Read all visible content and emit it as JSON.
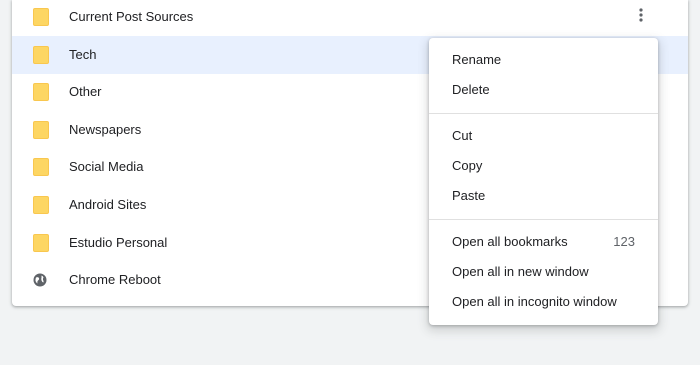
{
  "bookmarks": [
    {
      "label": "Current Post Sources",
      "icon": "folder-icon"
    },
    {
      "label": "Tech",
      "icon": "folder-icon",
      "selected": true
    },
    {
      "label": "Other",
      "icon": "folder-icon"
    },
    {
      "label": "Newspapers",
      "icon": "folder-icon"
    },
    {
      "label": "Social Media",
      "icon": "folder-icon"
    },
    {
      "label": "Android Sites",
      "icon": "folder-icon"
    },
    {
      "label": "Estudio Personal",
      "icon": "folder-icon"
    },
    {
      "label": "Chrome Reboot",
      "icon": "globe-icon"
    }
  ],
  "more_button": {
    "icon": "more-vert-icon"
  },
  "context_menu": {
    "rename": "Rename",
    "delete": "Delete",
    "cut": "Cut",
    "copy": "Copy",
    "paste": "Paste",
    "open_all": "Open all bookmarks",
    "open_all_count": "123",
    "open_new_window": "Open all in new window",
    "open_incognito": "Open all in incognito window"
  },
  "colors": {
    "selected_row": "#e8f0fe",
    "folder": "#fdd663",
    "background": "#f1f3f4"
  }
}
